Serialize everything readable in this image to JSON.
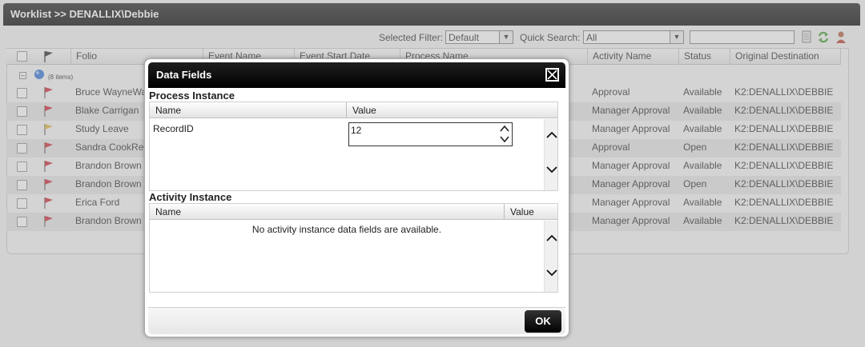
{
  "window": {
    "title": "Worklist >> DENALLIX\\Debbie"
  },
  "toolbar": {
    "selected_filter_label": "Selected Filter:",
    "selected_filter_value": "Default",
    "quick_search_label": "Quick Search:",
    "quick_search_value": "All",
    "search_text": ""
  },
  "grid": {
    "columns": [
      "Folio",
      "Event Name",
      "Event Start Date",
      "Process Name",
      "Activity Name",
      "Status",
      "Original Destination"
    ],
    "group_label": "(8 items)",
    "rows": [
      {
        "folio": "Bruce WayneWa",
        "activity": "Approval",
        "status": "Available",
        "destination": "K2:DENALLIX\\DEBBIE",
        "flag_color": "#c8202a"
      },
      {
        "folio": "Blake Carrigan",
        "activity": "Manager Approval",
        "status": "Available",
        "destination": "K2:DENALLIX\\DEBBIE",
        "flag_color": "#c8202a"
      },
      {
        "folio": "Study Leave",
        "activity": "Manager Approval",
        "status": "Available",
        "destination": "K2:DENALLIX\\DEBBIE",
        "flag_color": "#d9b23a"
      },
      {
        "folio": "Sandra CookRec",
        "activity": "Approval",
        "status": "Open",
        "destination": "K2:DENALLIX\\DEBBIE",
        "flag_color": "#c8202a"
      },
      {
        "folio": "Brandon Brown",
        "activity": "Manager Approval",
        "status": "Available",
        "destination": "K2:DENALLIX\\DEBBIE",
        "flag_color": "#c8202a"
      },
      {
        "folio": "Brandon Brown",
        "activity": "Manager Approval",
        "status": "Open",
        "destination": "K2:DENALLIX\\DEBBIE",
        "flag_color": "#c8202a"
      },
      {
        "folio": "Erica Ford",
        "activity": "Manager Approval",
        "status": "Available",
        "destination": "K2:DENALLIX\\DEBBIE",
        "flag_color": "#c8202a"
      },
      {
        "folio": "Brandon Brown",
        "activity": "Manager Approval",
        "status": "Available",
        "destination": "K2:DENALLIX\\DEBBIE",
        "flag_color": "#c8202a"
      }
    ]
  },
  "dialog": {
    "title": "Data Fields",
    "process_section_title": "Process Instance",
    "process_columns": {
      "name": "Name",
      "value": "Value"
    },
    "process_fields": [
      {
        "name": "RecordID",
        "value": "12"
      }
    ],
    "activity_section_title": "Activity Instance",
    "activity_columns": {
      "name": "Name",
      "value": "Value"
    },
    "activity_empty_message": "No activity instance data fields are available.",
    "ok_label": "OK"
  },
  "icons": {
    "close": "close-icon",
    "refresh": "refresh-icon",
    "user": "user-icon",
    "document": "document-icon",
    "flag": "flag-icon",
    "globe": "globe-icon"
  }
}
